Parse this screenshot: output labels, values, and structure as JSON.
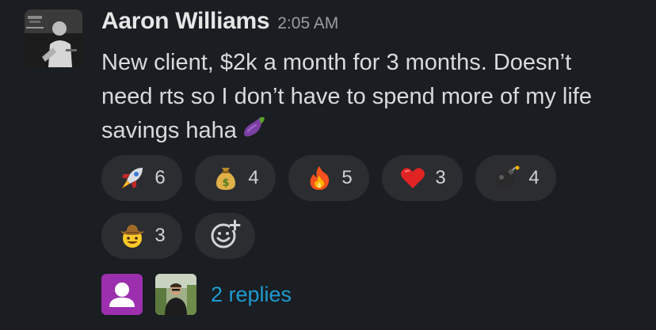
{
  "message": {
    "author": "Aaron Williams",
    "timestamp": "2:05 AM",
    "text": "New client, $2k a month for 3 months. Doesn’t need rts so I don’t have to spend more of my life savings haha",
    "inline_emoji": "eggplant-icon"
  },
  "reactions": [
    {
      "icon": "rocket-icon",
      "count": "6"
    },
    {
      "icon": "money-bag-icon",
      "count": "4"
    },
    {
      "icon": "fire-icon",
      "count": "5"
    },
    {
      "icon": "red-heart-icon",
      "count": "3"
    },
    {
      "icon": "bomb-icon",
      "count": "4"
    },
    {
      "icon": "cowboy-face-icon",
      "count": "3"
    }
  ],
  "add_reaction_icon": "add-reaction-icon",
  "thread": {
    "replies_label": "2 replies"
  },
  "colors": {
    "background": "#1a1d21",
    "pill": "#2b2d31",
    "link": "#1d9bd1",
    "default_avatar": "#9b2fae"
  }
}
